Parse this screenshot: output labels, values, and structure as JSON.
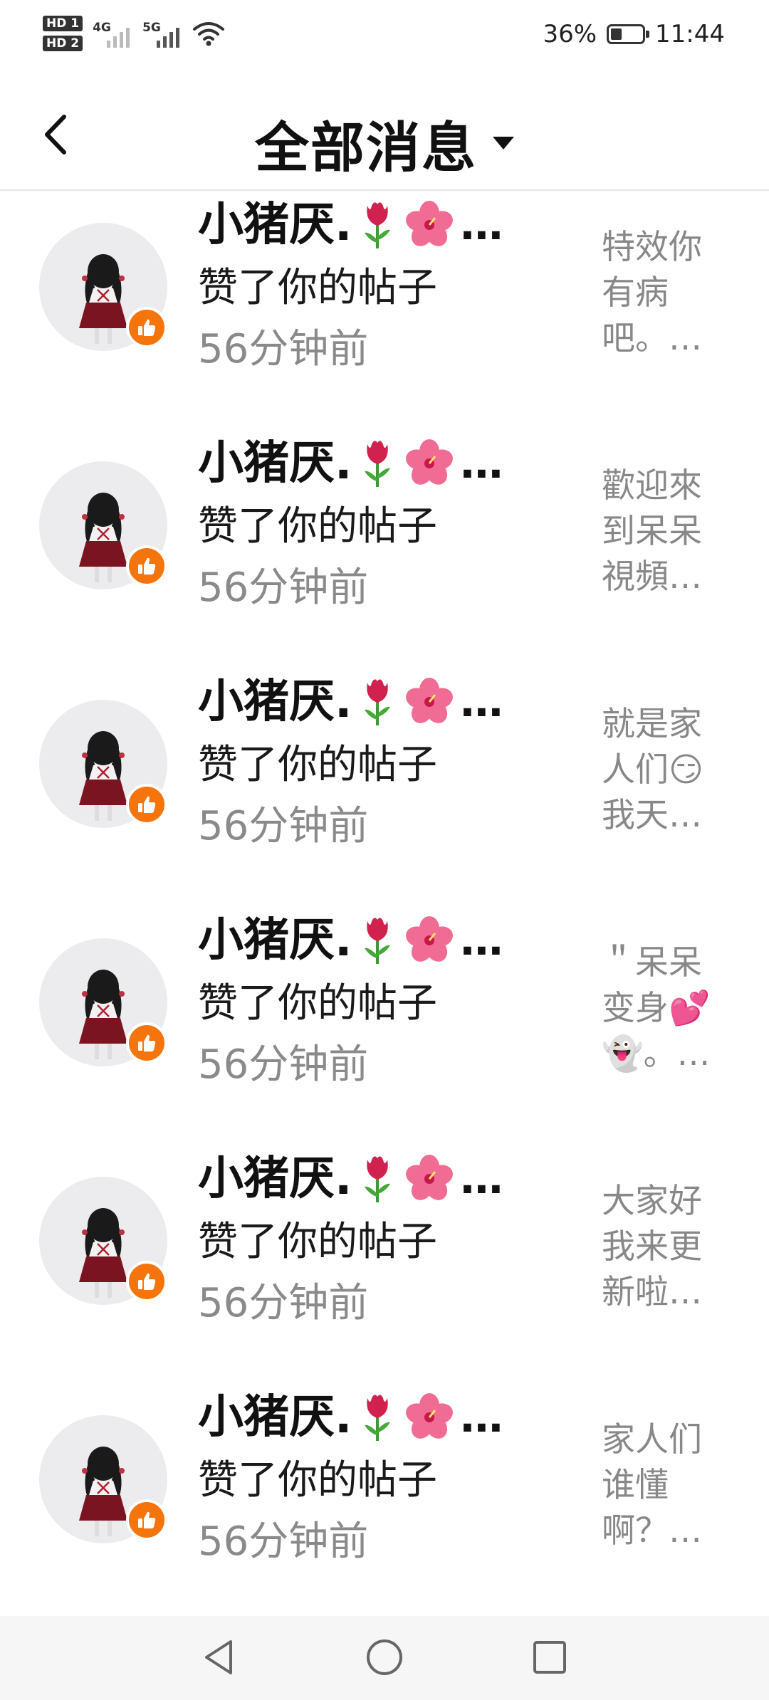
{
  "status_bar": {
    "hd1": "HD 1",
    "hd2": "HD 2",
    "sim1_network": "4G",
    "sim2_network": "5G",
    "battery_percent": "36%",
    "battery_level": 0.36,
    "time": "11:44"
  },
  "header": {
    "title": "全部消息",
    "back_icon": "chevron-left-icon",
    "dropdown_icon": "caret-down-icon"
  },
  "notifications": [
    {
      "name": "小猪厌.",
      "action": "赞了你的帖子",
      "time": "56分钟前",
      "preview": [
        "特效你",
        "有病",
        "吧。…"
      ]
    },
    {
      "name": "小猪厌.",
      "action": "赞了你的帖子",
      "time": "56分钟前",
      "preview": [
        "歡迎來",
        "到呆呆",
        "視頻…"
      ]
    },
    {
      "name": "小猪厌.",
      "action": "赞了你的帖子",
      "time": "56分钟前",
      "preview": [
        "就是家",
        "人们😏",
        "我天…"
      ]
    },
    {
      "name": "小猪厌.",
      "action": "赞了你的帖子",
      "time": "56分钟前",
      "preview": [
        "＂呆呆",
        "变身💕",
        "👻。…"
      ]
    },
    {
      "name": "小猪厌.",
      "action": "赞了你的帖子",
      "time": "56分钟前",
      "preview": [
        "大家好",
        "我来更",
        "新啦…"
      ]
    },
    {
      "name": "小猪厌.",
      "action": "赞了你的帖子",
      "time": "56分钟前",
      "preview": [
        "家人们",
        "谁懂",
        "啊？…"
      ]
    }
  ],
  "name_suffix": "…",
  "colors": {
    "like_badge": "#f5750c",
    "avatar_bg": "#ecebee",
    "time_text": "#8a8a8a",
    "preview_text": "#888888"
  },
  "navbar": {
    "back_icon": "triangle-back-icon",
    "home_icon": "circle-home-icon",
    "recents_icon": "square-recents-icon"
  }
}
